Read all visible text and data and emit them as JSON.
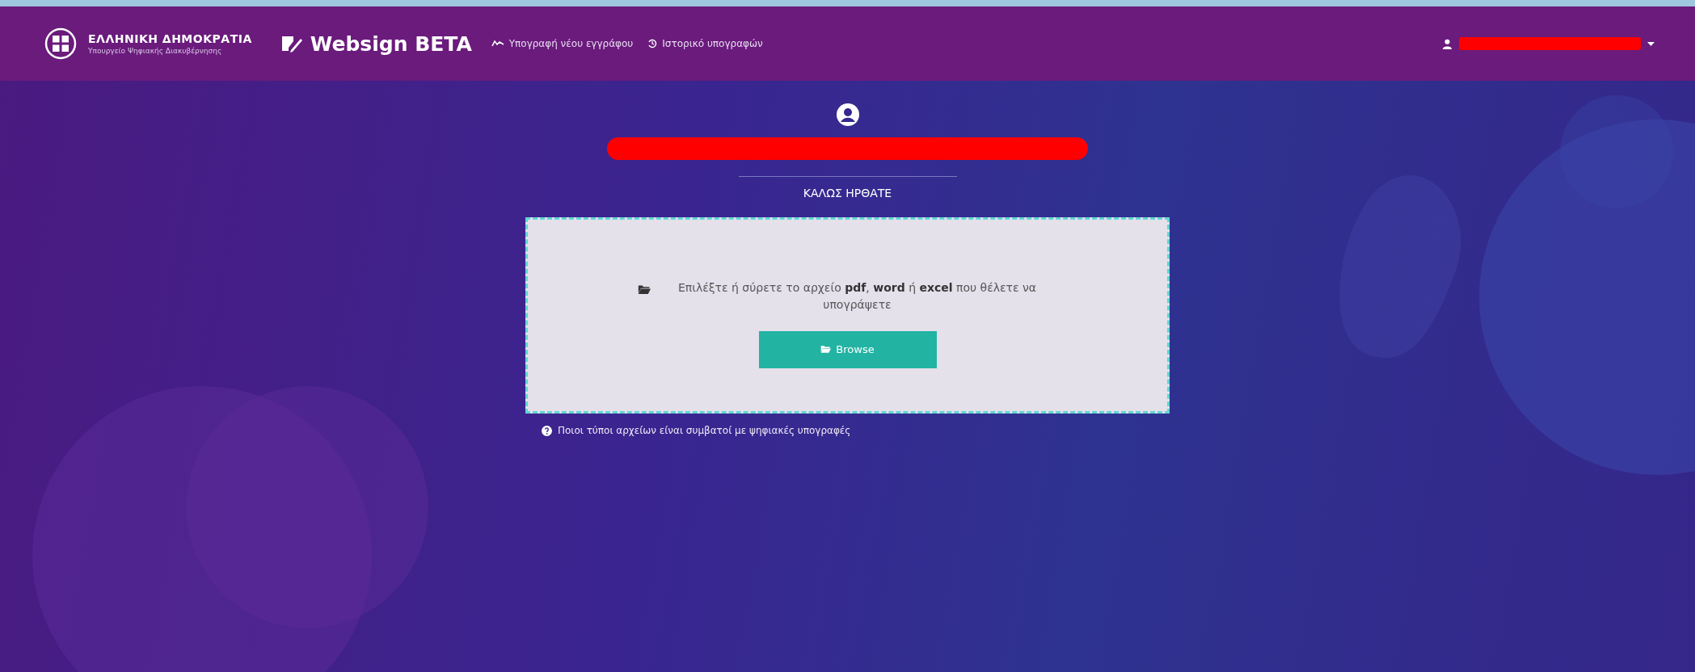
{
  "header": {
    "brand_title": "ΕΛΛΗΝΙΚΗ ΔΗΜΟΚΡΑΤΙΑ",
    "brand_subtitle": "Υπουργείο Ψηφιακής Διακυβέρνησης",
    "app_name": "Websign BETA",
    "nav": [
      {
        "label": "Υπογραφή νέου εγγράφου"
      },
      {
        "label": "Ιστορικό υπογραφών"
      }
    ],
    "user": {
      "redacted": true
    }
  },
  "profile": {
    "name_redacted": true,
    "welcome": "ΚΑΛΩΣ ΗΡΘΑΤΕ"
  },
  "upload": {
    "prompt": "Επιλέξτε ή σύρετε το αρχείο **pdf**, **word** ή **excel** που θέλετε να υπογράψετε",
    "button": "Browse"
  },
  "help_link": "Ποιοι τύποι αρχείων είναι συμβατοί με ψηφιακές υπογραφές"
}
